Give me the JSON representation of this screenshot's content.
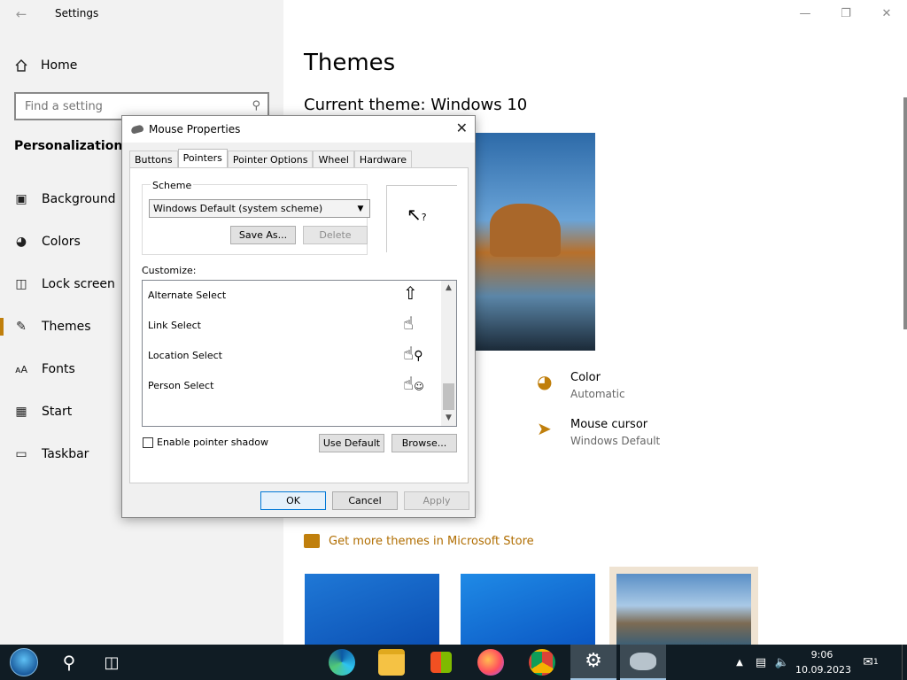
{
  "settings": {
    "title": "Settings",
    "home_label": "Home",
    "search_placeholder": "Find a setting",
    "section": "Personalization",
    "nav": [
      {
        "label": "Background",
        "icon": "picture-icon"
      },
      {
        "label": "Colors",
        "icon": "palette-icon"
      },
      {
        "label": "Lock screen",
        "icon": "lock-screen-icon"
      },
      {
        "label": "Themes",
        "icon": "themes-icon"
      },
      {
        "label": "Fonts",
        "icon": "fonts-icon"
      },
      {
        "label": "Start",
        "icon": "start-icon"
      },
      {
        "label": "Taskbar",
        "icon": "taskbar-icon"
      }
    ],
    "active_nav": "Themes",
    "page_title": "Themes",
    "current_theme": "Current theme: Windows 10",
    "color_label": "Color",
    "color_value": "Automatic",
    "cursor_label": "Mouse cursor",
    "cursor_value": "Windows Default",
    "store_link": "Get more themes in Microsoft Store",
    "accent_color": "#c07f0c"
  },
  "dialog": {
    "title": "Mouse Properties",
    "tabs": [
      "Buttons",
      "Pointers",
      "Pointer Options",
      "Wheel",
      "Hardware"
    ],
    "active_tab": "Pointers",
    "scheme_label": "Scheme",
    "scheme_value": "Windows Default (system scheme)",
    "save_as": "Save As...",
    "delete": "Delete",
    "customize_label": "Customize:",
    "cursors": [
      {
        "name": "Alternate Select",
        "icon": "arrow-up-icon"
      },
      {
        "name": "Link Select",
        "icon": "hand-icon"
      },
      {
        "name": "Location Select",
        "icon": "hand-pin-icon"
      },
      {
        "name": "Person Select",
        "icon": "hand-person-icon"
      }
    ],
    "shadow_label": "Enable pointer shadow",
    "use_default": "Use Default",
    "browse": "Browse...",
    "ok": "OK",
    "cancel": "Cancel",
    "apply": "Apply"
  },
  "taskbar": {
    "time": "9:06",
    "date": "10.09.2023",
    "notifications": "1",
    "pinned": [
      "edge-icon",
      "file-explorer-icon",
      "microsoft-store-icon",
      "firefox-icon",
      "chrome-icon",
      "settings-icon",
      "mouse-properties-icon"
    ]
  }
}
